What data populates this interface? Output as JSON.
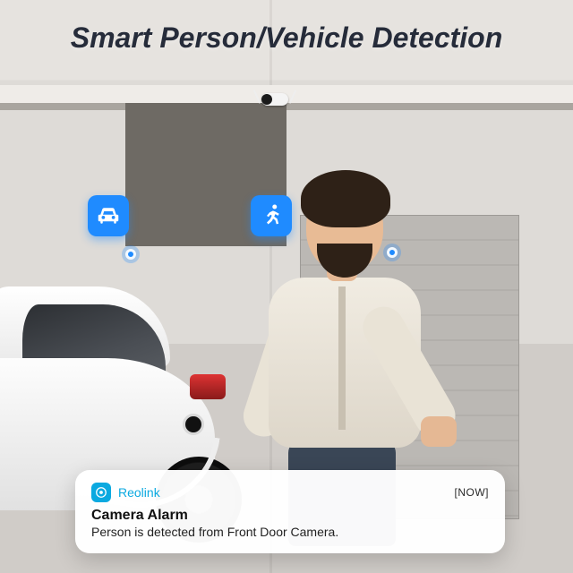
{
  "headline": "Smart Person/Vehicle Detection",
  "badges": {
    "vehicle": {
      "label": "vehicle-detection"
    },
    "person": {
      "label": "person-detection"
    }
  },
  "notification": {
    "app_name": "Reolink",
    "time": "[NOW]",
    "title": "Camera Alarm",
    "body": "Person is detected from Front Door Camera."
  }
}
